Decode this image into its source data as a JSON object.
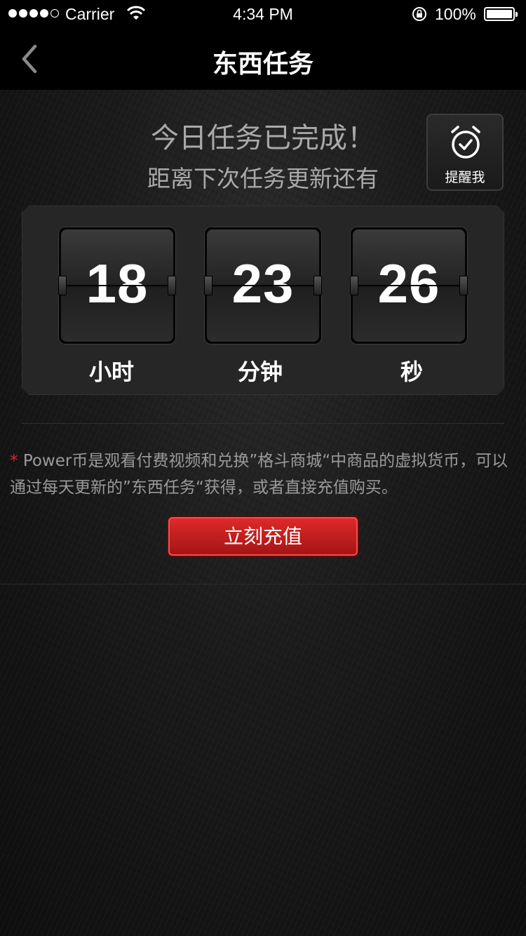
{
  "status_bar": {
    "carrier": "Carrier",
    "time": "4:34 PM",
    "battery": "100%"
  },
  "nav": {
    "title": "东西任务"
  },
  "header": {
    "title": "今日任务已完成！",
    "subtitle": "距离下次任务更新还有"
  },
  "remind": {
    "label": "提醒我"
  },
  "countdown": {
    "hours": "18",
    "hours_unit": "小时",
    "minutes": "23",
    "minutes_unit": "分钟",
    "seconds": "26",
    "seconds_unit": "秒"
  },
  "note": {
    "star": "*",
    "text": "Power币是观看付费视频和兑换”格斗商城“中商品的虚拟货币，可以通过每天更新的”东西任务“获得，或者直接充值购买。"
  },
  "recharge": {
    "label": "立刻充值"
  },
  "colors": {
    "accent": "#c41e1e",
    "background": "#141414"
  }
}
